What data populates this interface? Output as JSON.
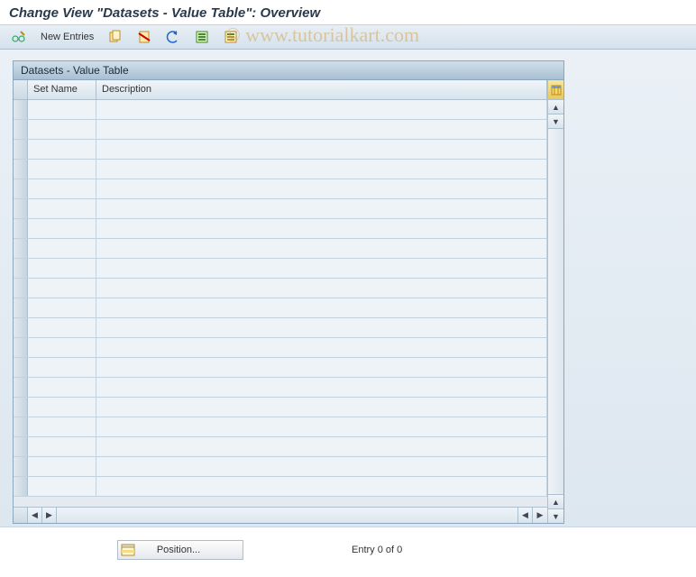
{
  "page_title": "Change View \"Datasets - Value Table\": Overview",
  "watermark": "© www.tutorialkart.com",
  "toolbar": {
    "new_entries_label": "New Entries"
  },
  "grid": {
    "title": "Datasets - Value Table",
    "columns": {
      "set_name": "Set Name",
      "description": "Description"
    },
    "rows": [],
    "blank_row_count": 20
  },
  "footer": {
    "position_label": "Position...",
    "entry_label": "Entry 0 of 0"
  }
}
